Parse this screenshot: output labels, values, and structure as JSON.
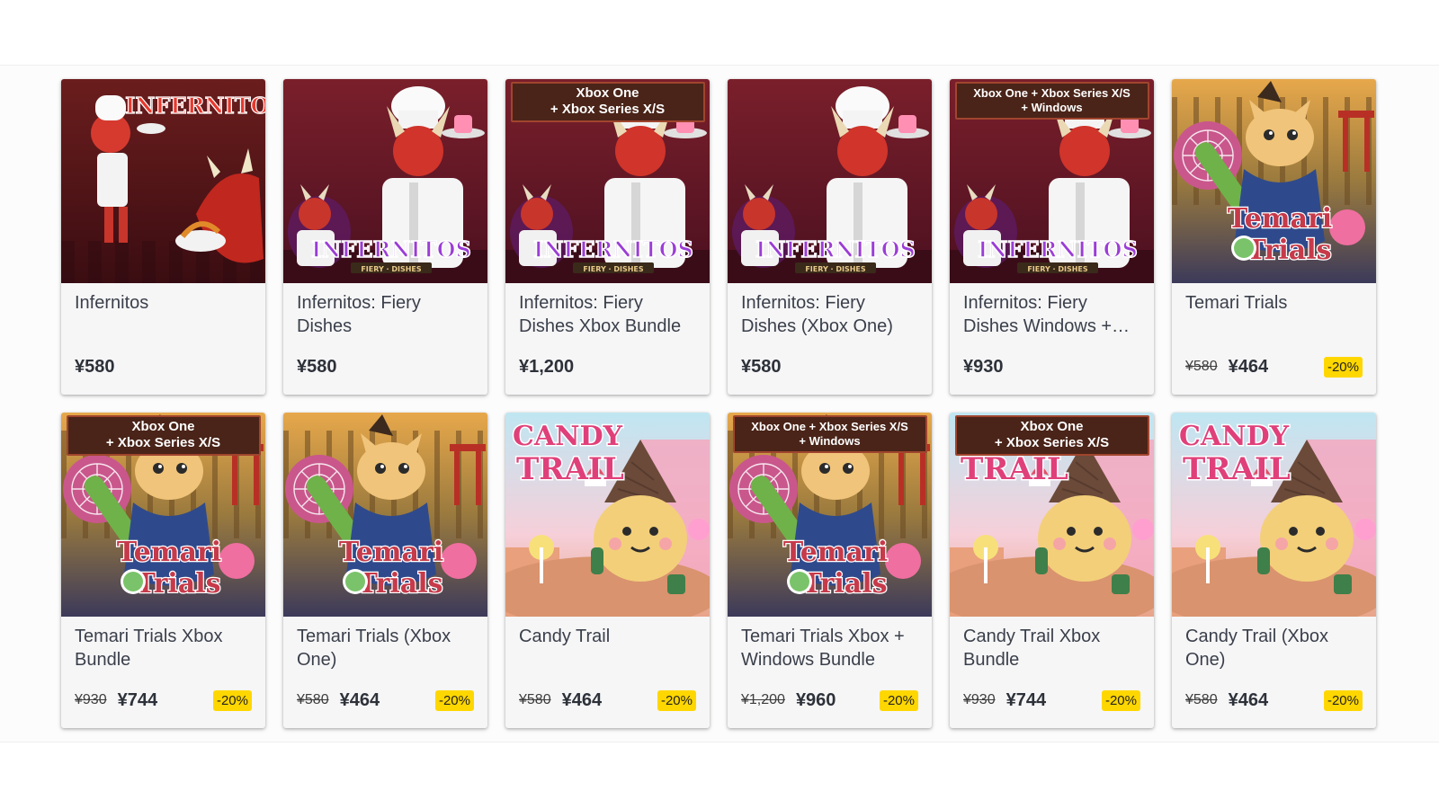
{
  "colors": {
    "discount_badge": "#ffd700",
    "banner_bg": "#4a2418",
    "card_bg": "#f6f6f7"
  },
  "products": [
    {
      "title": "Infernitos",
      "price": "¥580",
      "art": "infernitos-classic"
    },
    {
      "title": "Infernitos: Fiery Dishes",
      "price": "¥580",
      "art": "infernitos-fiery"
    },
    {
      "title": "Infernitos: Fiery Dishes Xbox Bundle",
      "price": "¥1,200",
      "banner": "Xbox One\n+ Xbox Series X/S",
      "art": "infernitos-fiery"
    },
    {
      "title": "Infernitos: Fiery Dishes (Xbox One)",
      "price": "¥580",
      "art": "infernitos-fiery"
    },
    {
      "title": "Infernitos: Fiery Dishes Windows +…",
      "price": "¥930",
      "banner": "Xbox One + Xbox Series X/S\n+ Windows",
      "art": "infernitos-fiery"
    },
    {
      "title": "Temari Trials",
      "old_price": "¥580",
      "price": "¥464",
      "discount": "-20%",
      "art": "temari-trials"
    },
    {
      "title": "Temari Trials Xbox Bundle",
      "old_price": "¥930",
      "price": "¥744",
      "discount": "-20%",
      "banner": "Xbox One\n+ Xbox Series X/S",
      "art": "temari-trials"
    },
    {
      "title": "Temari Trials (Xbox One)",
      "old_price": "¥580",
      "price": "¥464",
      "discount": "-20%",
      "art": "temari-trials"
    },
    {
      "title": "Candy Trail",
      "old_price": "¥580",
      "price": "¥464",
      "discount": "-20%",
      "art": "candy-trail"
    },
    {
      "title": "Temari Trials Xbox + Windows Bundle",
      "old_price": "¥1,200",
      "price": "¥960",
      "discount": "-20%",
      "banner": "Xbox One + Xbox Series X/S\n+ Windows",
      "art": "temari-trials"
    },
    {
      "title": "Candy Trail Xbox Bundle",
      "old_price": "¥930",
      "price": "¥744",
      "discount": "-20%",
      "banner": "Xbox One\n+ Xbox Series X/S",
      "art": "candy-trail"
    },
    {
      "title": "Candy Trail (Xbox One)",
      "old_price": "¥580",
      "price": "¥464",
      "discount": "-20%",
      "art": "candy-trail"
    }
  ]
}
